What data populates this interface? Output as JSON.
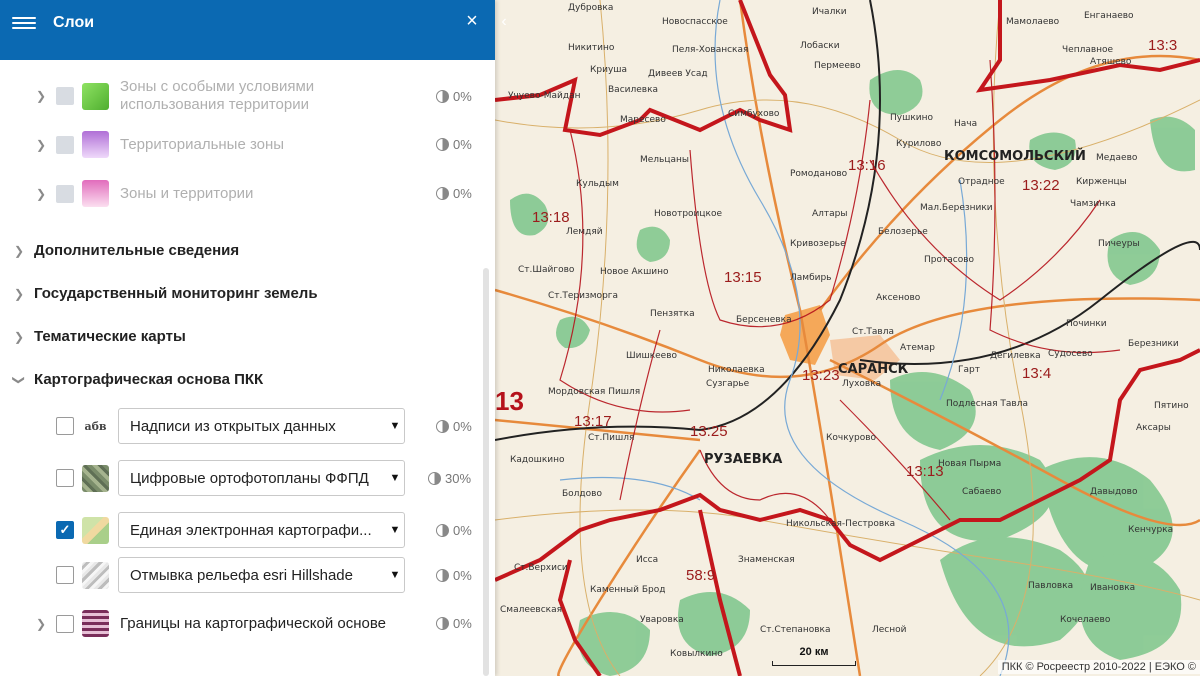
{
  "panel": {
    "title": "Слои",
    "layers_top": [
      {
        "label_lines": [
          "Зоны с особыми условиями",
          "использования территории"
        ],
        "opacity": "0%",
        "swatch_colors": [
          "#7fd657",
          "#5ab93a"
        ]
      },
      {
        "label_lines": [
          "Территориальные зоны"
        ],
        "opacity": "0%",
        "swatch_colors": [
          "#d3a6ec",
          "#a866cc"
        ]
      },
      {
        "label_lines": [
          "Зоны и территории"
        ],
        "opacity": "0%",
        "swatch_colors": [
          "#f3a9d9",
          "#d96db8"
        ]
      }
    ],
    "sections": [
      {
        "label": "Дополнительные сведения"
      },
      {
        "label": "Государственный мониторинг земель"
      },
      {
        "label": "Тематические карты"
      },
      {
        "label": "Картографическая основа ПКК"
      }
    ],
    "base_layers": [
      {
        "thumb_text": "абв",
        "select": "Надписи из открытых данных",
        "opacity": "0%",
        "checked": false
      },
      {
        "thumb_text": "",
        "select": "Цифровые ортофотопланы ФФПД",
        "opacity": "30%",
        "checked": false
      },
      {
        "thumb_text": "",
        "select": "Единая электронная картографи...",
        "opacity": "0%",
        "checked": true
      },
      {
        "thumb_text": "",
        "select": "Отмывка рельефа esri Hillshade",
        "opacity": "0%",
        "checked": false
      }
    ],
    "last_layer": {
      "label": "Границы на картографической основе",
      "opacity": "0%"
    }
  },
  "map": {
    "attribution": "ПКК © Росреестр 2010-2022 | ЕЭКО ©",
    "scale_label": "20 км",
    "cities": [
      "САРАНСК",
      "РУЗАЕВКА",
      "КОМСОМОЛЬСКИЙ"
    ],
    "districts": [
      "13:3",
      "13:16",
      "13:22",
      "13:18",
      "13:15",
      "13:23",
      "13:4",
      "13:17",
      "13:25",
      "13:13",
      "58:9",
      "13"
    ],
    "towns": [
      "Дубровка",
      "Новоспасское",
      "Ичалки",
      "Никитино",
      "Пеля-Хованская",
      "Лобаски",
      "Криуша",
      "Дивеев Усад",
      "Пермеево",
      "Учуево-Майдан",
      "Василевка",
      "Симбухово",
      "Маресево",
      "Мельцаны",
      "Кульдым",
      "Ромоданово",
      "Лемдяй",
      "Новотроицкое",
      "Алтары",
      "Кривозерье",
      "Ст.Шайгово",
      "Новое Акшино",
      "Ламбирь",
      "Ст.Теризморга",
      "Берсеневка",
      "Пензятка",
      "Шишкеево",
      "Николаевка",
      "Сузгарье",
      "Мордовская Пишля",
      "Ст.Пишля",
      "Кадошкино",
      "Болдово",
      "Исса",
      "Знаменская",
      "Никольская-Пестровка",
      "Ст.Верхиси",
      "Каменный Брод",
      "Смалеевская",
      "Уваровка",
      "Ст.Степановка",
      "Ковылкино",
      "Пушкино",
      "Курилово",
      "Отрадное",
      "Мал.Березники",
      "Протасово",
      "Белозерье",
      "Аксеново",
      "Ст.Тавла",
      "Атемар",
      "Луховка",
      "Гарт",
      "Дегилевка",
      "Подлесная Тавла",
      "Кочкурово",
      "Сабаево",
      "Новая Пырма",
      "Пичеуры",
      "Чамзинка",
      "Медаево",
      "Кирженцы",
      "Починки",
      "Судосево",
      "Березники",
      "Пятино",
      "Аксары",
      "Давыдово",
      "Кенчурка",
      "Павловка",
      "Ивановка",
      "Лесной",
      "Кочелаево",
      "Атяшево",
      "Чеплавное",
      "Енганаево",
      "Нача",
      "Мамолаево"
    ]
  },
  "colors": {
    "header_bg": "#0b69b2",
    "checkbox_checked": "#0b69b2",
    "map_bg": "#f5efe2",
    "forest": "#7cc58a",
    "district_border": "#b5121b",
    "road": "#e78a3c"
  },
  "icons": [
    "menu-icon",
    "close-icon",
    "chevron-right-icon",
    "chevron-down-icon",
    "opacity-icon",
    "dropdown-caret-icon",
    "collapse-panel-icon"
  ]
}
